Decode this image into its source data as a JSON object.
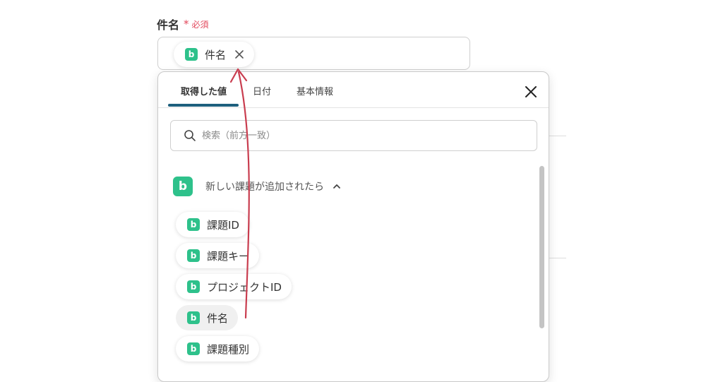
{
  "field": {
    "label": "件名",
    "required_mark": "*",
    "required_text": "必須",
    "selected_chip": {
      "label": "件名",
      "app_icon": "b"
    }
  },
  "popup": {
    "tabs": [
      {
        "label": "取得した値"
      },
      {
        "label": "日付"
      },
      {
        "label": "基本情報"
      }
    ],
    "search": {
      "placeholder": "検索（前方一致）"
    },
    "group": {
      "label": "新しい課題が追加されたら",
      "app_icon": "b"
    },
    "items": [
      {
        "label": "課題ID",
        "app_icon": "b"
      },
      {
        "label": "課題キー",
        "app_icon": "b"
      },
      {
        "label": "プロジェクトID",
        "app_icon": "b"
      },
      {
        "label": "件名",
        "app_icon": "b"
      },
      {
        "label": "課題種別",
        "app_icon": "b"
      }
    ]
  },
  "colors": {
    "accent": "#1d5f7d",
    "app_green": "#2ec18b",
    "required": "#e2475b",
    "arrow": "#c93d4f"
  },
  "icons": [
    "close-icon",
    "search-icon",
    "chevron-up-icon",
    "app-logo-icon",
    "arrow-annotation"
  ]
}
